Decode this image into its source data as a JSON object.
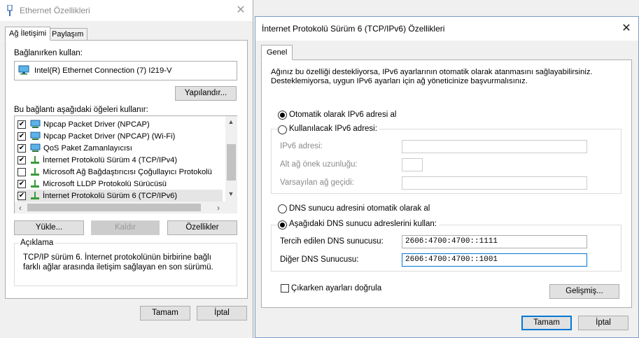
{
  "left": {
    "title": "Ethernet Özellikleri",
    "tabs": [
      "Ağ İletişimi",
      "Paylaşım"
    ],
    "connect_using_label": "Bağlanırken kullan:",
    "adapter_name": "Intel(R) Ethernet Connection (7) I219-V",
    "configure_button": "Yapılandır...",
    "items_label": "Bu bağlantı aşağıdaki öğeleri kullanır:",
    "items": [
      {
        "label": "Npcap Packet Driver (NPCAP)",
        "checked": true,
        "icon": "network-icon"
      },
      {
        "label": "Npcap Packet Driver (NPCAP) (Wi-Fi)",
        "checked": true,
        "icon": "network-icon"
      },
      {
        "label": "QoS Paket Zamanlayıcısı",
        "checked": true,
        "icon": "network-icon"
      },
      {
        "label": "İnternet Protokolü Sürüm 4 (TCP/IPv4)",
        "checked": true,
        "icon": "protocol-icon"
      },
      {
        "label": "Microsoft Ağ Bağdaştırıcısı Çoğullayıcı Protokolü",
        "checked": false,
        "icon": "protocol-icon"
      },
      {
        "label": "Microsoft LLDP Protokolü Sürücüsü",
        "checked": true,
        "icon": "protocol-icon"
      },
      {
        "label": "İnternet Protokolü Sürüm 6 (TCP/IPv6)",
        "checked": true,
        "icon": "protocol-icon"
      }
    ],
    "install_button": "Yükle...",
    "uninstall_button": "Kaldır",
    "properties_button": "Özellikler",
    "description_title": "Açıklama",
    "description_text": "TCP/IP sürüm 6. İnternet protokolünün birbirine bağlı farklı ağlar arasında iletişim sağlayan en son sürümü.",
    "ok_button": "Tamam",
    "cancel_button": "İptal"
  },
  "right": {
    "title": "İnternet Protokolü Sürüm 6 (TCP/IPv6) Özellikleri",
    "tab": "Genel",
    "info_line1": "Ağınız bu özelliği destekliyorsa, IPv6 ayarlarının otomatik olarak atanmasını sağlayabilirsiniz.",
    "info_line2": "Desteklemiyorsa, uygun IPv6 ayarları için ağ yöneticinize başvurmalısınız.",
    "auto_ip_label": "Otomatik olarak IPv6 adresi al",
    "manual_ip_label": "Kullanılacak IPv6 adresi:",
    "ipv6_address_label": "IPv6 adresi:",
    "prefix_label": "Alt ağ önek uzunluğu:",
    "gateway_label": "Varsayılan ağ geçidi:",
    "auto_dns_label": "DNS sunucu adresini otomatik olarak al",
    "manual_dns_label": "Aşağıdaki DNS sunucu adreslerini kullan:",
    "preferred_dns_label": "Tercih edilen DNS sunucusu:",
    "preferred_dns_value": "2606:4700:4700::1111",
    "alternate_dns_label": "Diğer DNS Sunucusu:",
    "alternate_dns_value": "2606:4700:4700::1001",
    "validate_label": "Çıkarken ayarları doğrula",
    "advanced_button": "Gelişmiş...",
    "ok_button": "Tamam",
    "cancel_button": "İptal"
  }
}
